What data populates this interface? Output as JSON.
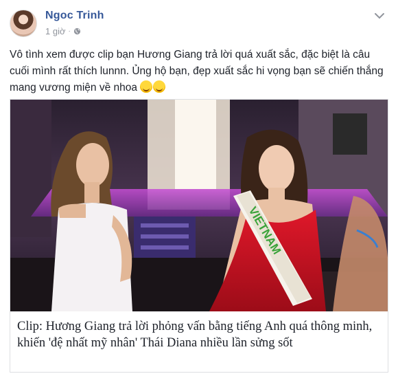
{
  "post": {
    "author": "Ngoc Trinh",
    "time": "1 giờ",
    "text": "Vô tình xem được clip bạn Hương Giang trả lời quá xuất sắc, đặc biệt là câu cuối mình rất thích lunnn. Ủng hộ bạn, đẹp xuất sắc hi vọng bạn sẽ chiến thắng mang vương miện về nhoa",
    "emojis": [
      "grinning-sweat-emoji",
      "grinning-sweat-emoji"
    ]
  },
  "link": {
    "title": "Clip: Hương Giang trả lời phỏng vấn bằng tiếng Anh quá thông minh, khiến 'đệ nhất mỹ nhân' Thái Diana nhiều lần sửng sốt",
    "sash_text": "VIETNAM"
  },
  "icons": {
    "privacy": "globe-icon",
    "options": "chevron-down-icon"
  },
  "colors": {
    "author": "#365899",
    "meta": "#90949c",
    "text": "#1d2129",
    "dress_red": "#c8101e",
    "sash_green": "#3aa33a"
  }
}
